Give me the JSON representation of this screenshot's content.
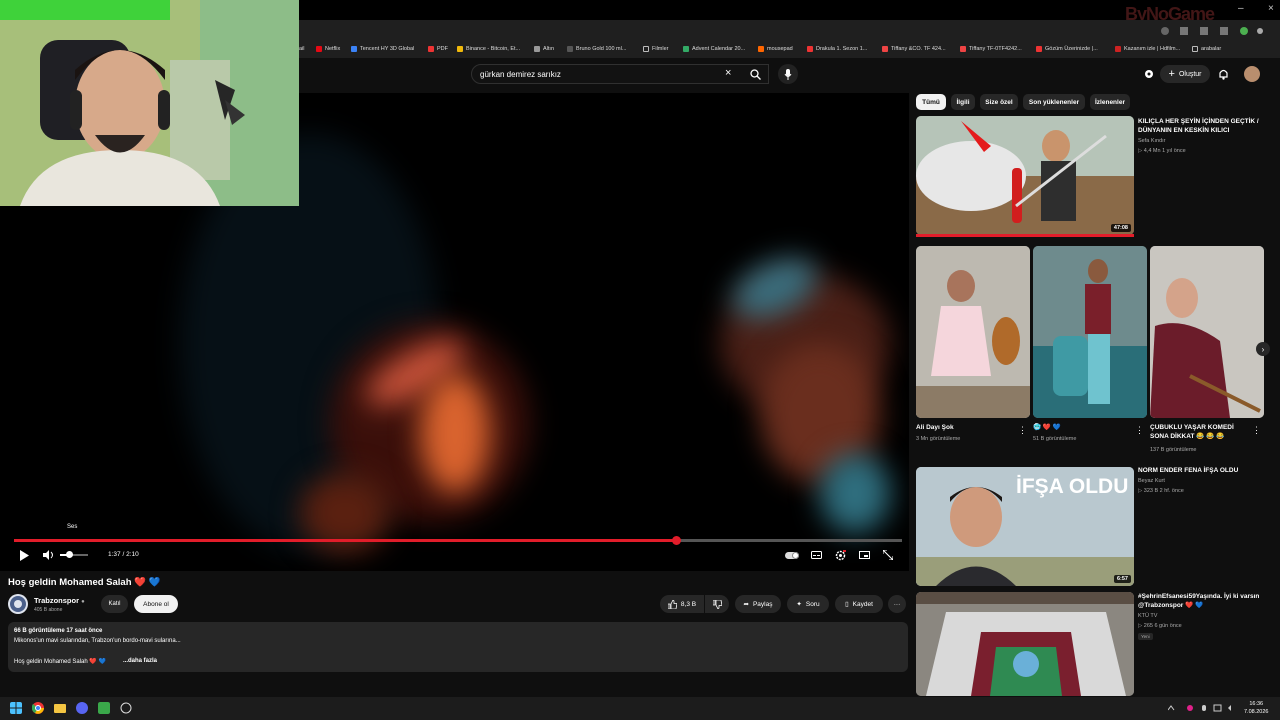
{
  "browser": {
    "bookmarks": [
      "ail",
      "Netflix",
      "Tencent HY 3D Global",
      "PDF",
      "Binance - Bitcoin, Et...",
      "Altın",
      "Bruno Gold 100 ml...",
      "Filmler",
      "Advent Calendar 20...",
      "mousepad",
      "Drakula 1. Sezon 1...",
      "Tiffany &CO. TF 424...",
      "Tiffany TF-0TF4242...",
      "Gözüm Üzerinizde |...",
      "Kazanım izle | Hdfilm...",
      "arabalar"
    ],
    "watermark": "ByNoGame"
  },
  "header": {
    "search_value": "gürkan demirez sarıkız",
    "clear_icon": "×",
    "create_label": "Oluştur"
  },
  "player": {
    "progress_fraction": 0.745,
    "time": "1:37 / 2:10",
    "volume_tooltip": "Ses"
  },
  "video": {
    "title": "Hoş geldin Mohamed Salah ❤️ 💙",
    "channel": "Trabzonspor",
    "subscribers": "405 B abone",
    "join_label": "Katıl",
    "subscribe_label": "Abone ol",
    "likes": "8,3 B",
    "share_label": "Paylaş",
    "ask_label": "Soru",
    "save_label": "Kaydet",
    "desc_stats": "66 B görüntüleme  17 saat önce",
    "desc_line": "Mikonos'un mavi sularından, Trabzon'un bordo-mavi sularına...",
    "desc_tags": "Hoş geldin Mohamed Salah ❤️ 💙",
    "desc_more": "...daha fazla"
  },
  "sidebar": {
    "chips": [
      "Tümü",
      "İlgili",
      "Size özel",
      "Son yüklenenler",
      "İzlenenler"
    ],
    "rec1": {
      "title": "KILIÇLA HER ŞEYİN İÇİNDEN GEÇTİK / DÜNYANIN EN KESKİN KILICI",
      "channel": "Sefa Kındır",
      "meta": "▷ 4,4 Mn  1 yıl önce",
      "duration": "47:08"
    },
    "shorts": [
      {
        "title": "Ali Dayı Şok",
        "meta": "3 Mn görüntüleme"
      },
      {
        "title": "🥶 ❤️ 💙",
        "meta": "51 B görüntüleme"
      },
      {
        "title": "ÇUBUKLU YAŞAR KOMEDİ SONA DİKKAT 😂 😂 😂",
        "meta": "137 B görüntüleme"
      }
    ],
    "rec2": {
      "title": "NORM ENDER FENA İFŞA OLDU",
      "channel": "Beyaz Kurt",
      "meta": "▷ 323 B  2 hf. önce",
      "duration": "6:57",
      "thumb_text": "İFŞA OLDU"
    },
    "rec3": {
      "title": "#ŞehrinEfsanesi59Yaşında. İyi ki varsın @Trabzonspor ❤️ 💙",
      "channel": "KTÜ TV",
      "meta": "▷ 265  6 gün önce",
      "badge": "Yeni"
    }
  },
  "taskbar": {
    "time": "16:36",
    "date": "7.08.2026"
  }
}
